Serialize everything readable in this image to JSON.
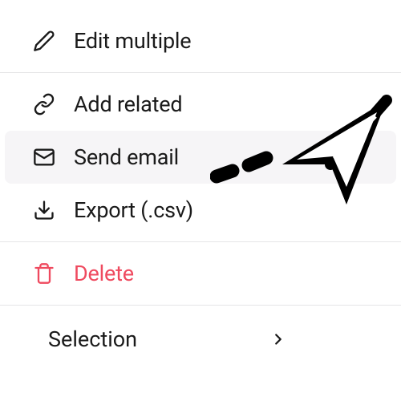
{
  "menu": {
    "edit_multiple": "Edit multiple",
    "add_related": "Add related",
    "send_email": "Send email",
    "export_csv": "Export (.csv)",
    "delete": "Delete",
    "selection": "Selection"
  },
  "colors": {
    "danger": "#ef4a5f",
    "text": "#1a1a1a",
    "divider": "#e5e5e7",
    "highlight_bg": "#f6f5f7"
  }
}
